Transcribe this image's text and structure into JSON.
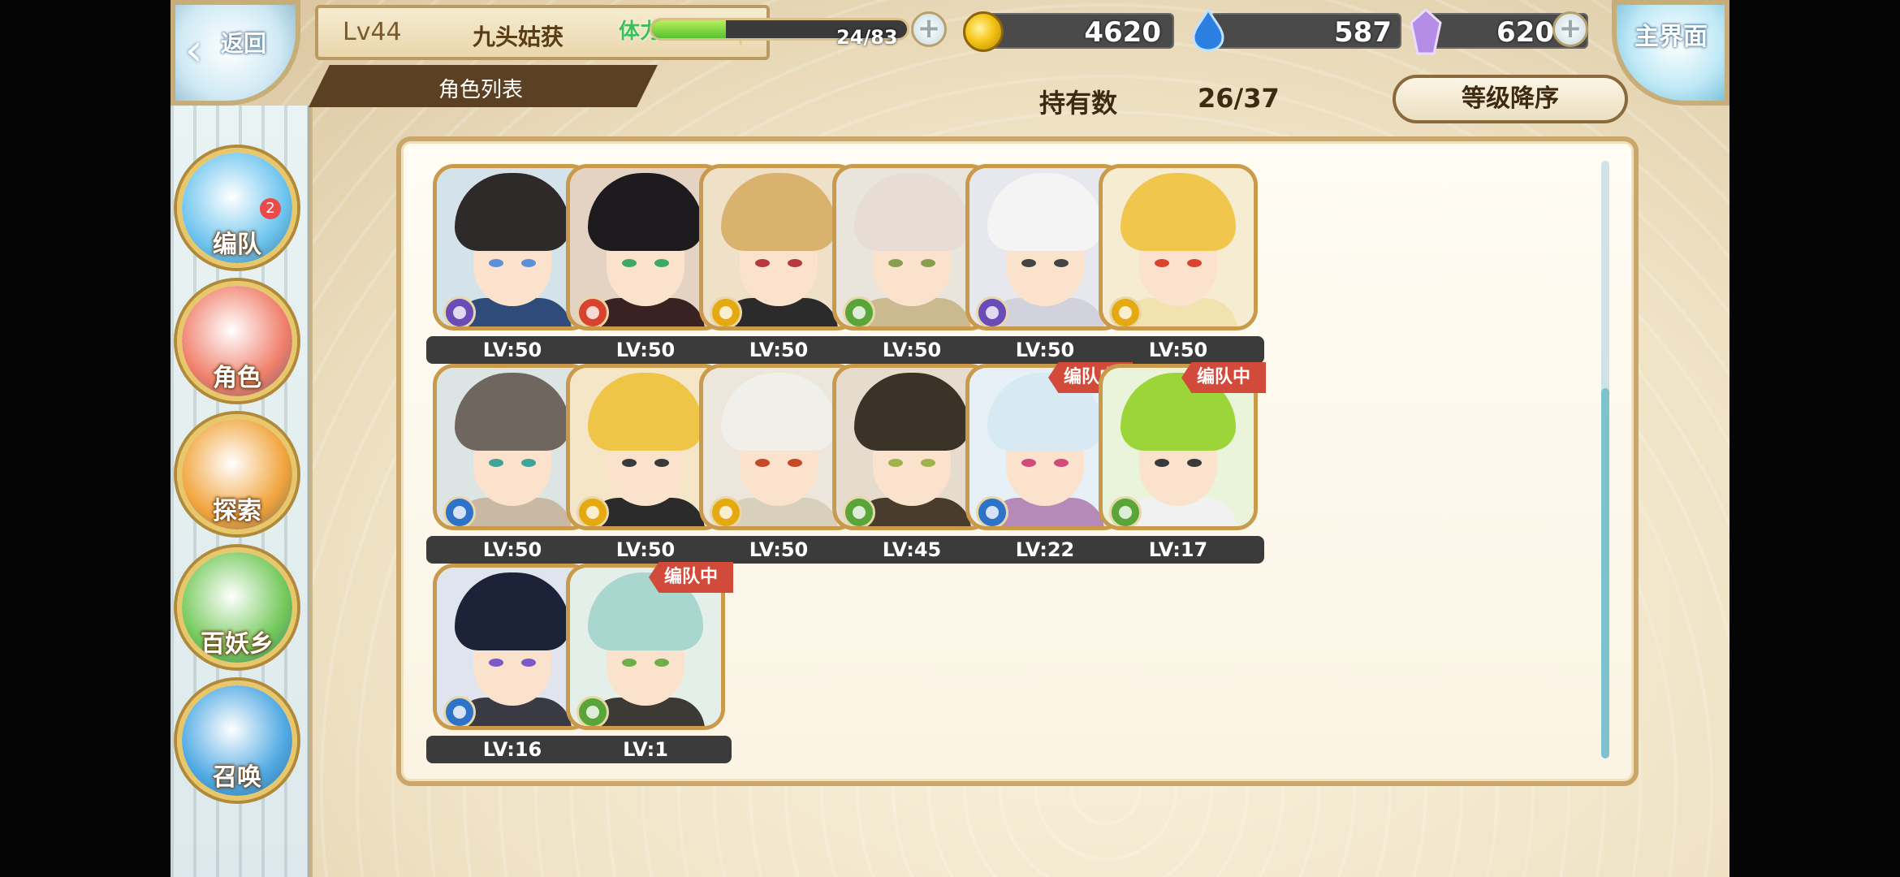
{
  "header": {
    "back_label": "返回",
    "player_level": "Lv44",
    "player_name": "九头姑获",
    "screen_title": "角色列表",
    "home_label": "主界面"
  },
  "resources": {
    "stamina_label": "体力",
    "stamina_current": 24,
    "stamina_max": 83,
    "stamina_text": "24/83",
    "gold": "4620",
    "spirit": "587",
    "crystal": "620",
    "colors": {
      "stamina": "#6fd43a",
      "gold": "#f5c518",
      "spirit": "#2a7fe0",
      "crystal": "#b58ce6"
    }
  },
  "sidebar": {
    "items": [
      {
        "label": "编队",
        "icon": "team-icon",
        "badge": "2",
        "color": "#6cc4ee"
      },
      {
        "label": "角色",
        "icon": "character-icon",
        "color": "#f07f6b"
      },
      {
        "label": "探索",
        "icon": "explore-icon",
        "color": "#f1a43c"
      },
      {
        "label": "百妖乡",
        "icon": "village-icon",
        "color": "#74c95b"
      },
      {
        "label": "召唤",
        "icon": "summon-icon",
        "color": "#4fa9e3"
      }
    ]
  },
  "roster": {
    "count_label": "持有数",
    "count_value": "26/37",
    "sort_label": "等级降序",
    "team_badge_text": "编队中",
    "scroll_position": 0.38,
    "characters": [
      {
        "level": "LV:50",
        "element": "purple",
        "hair": "#2f2a2a",
        "eye": "#5c8fd8",
        "bg": "#d4e3ea",
        "outfit": "#2e4b7a",
        "in_team": false
      },
      {
        "level": "LV:50",
        "element": "red",
        "hair": "#1e1b1f",
        "eye": "#3ea86b",
        "bg": "#e4d2c2",
        "outfit": "#3a2222",
        "in_team": false
      },
      {
        "level": "LV:50",
        "element": "yellow",
        "hair": "#d9b26e",
        "eye": "#b6393f",
        "bg": "#efe0c8",
        "outfit": "#2b2b2b",
        "in_team": false
      },
      {
        "level": "LV:50",
        "element": "green",
        "hair": "#e8ddd4",
        "eye": "#8a9e52",
        "bg": "#e9e4dc",
        "outfit": "#cbb98f",
        "in_team": false
      },
      {
        "level": "LV:50",
        "element": "purple",
        "hair": "#f4f4f4",
        "eye": "#444444",
        "bg": "#e7e7ee",
        "outfit": "#d2d2dc",
        "in_team": false
      },
      {
        "level": "LV:50",
        "element": "yellow",
        "hair": "#f0c64c",
        "eye": "#d9452e",
        "bg": "#f6ecd2",
        "outfit": "#f2e2b0",
        "in_team": false
      },
      {
        "level": "LV:50",
        "element": "blue",
        "hair": "#6f6660",
        "eye": "#3fa39a",
        "bg": "#dde4e4",
        "outfit": "#c9b8a4",
        "in_team": false
      },
      {
        "level": "LV:50",
        "element": "yellow",
        "hair": "#efc548",
        "eye": "#3a3a3a",
        "bg": "#f4e6c6",
        "outfit": "#2b2b2b",
        "in_team": false
      },
      {
        "level": "LV:50",
        "element": "yellow",
        "hair": "#f1efe9",
        "eye": "#c44a2a",
        "bg": "#ece6dc",
        "outfit": "#d9cfbd",
        "in_team": false
      },
      {
        "level": "LV:45",
        "element": "green",
        "hair": "#3b3228",
        "eye": "#9fb24b",
        "bg": "#e6dccd",
        "outfit": "#4a3c2c",
        "in_team": false
      },
      {
        "level": "LV:22",
        "element": "blue",
        "hair": "#d7e9f3",
        "eye": "#d04a7a",
        "bg": "#e6f0f6",
        "outfit": "#b58ab8",
        "in_team": true
      },
      {
        "level": "LV:17",
        "element": "green",
        "hair": "#9cd53a",
        "eye": "#3a3a3a",
        "bg": "#eaf4da",
        "outfit": "#f1f1f1",
        "in_team": true
      },
      {
        "level": "LV:16",
        "element": "blue",
        "hair": "#1c2338",
        "eye": "#7a5ac9",
        "bg": "#dfe4ee",
        "outfit": "#3a3a44",
        "in_team": false
      },
      {
        "level": "LV:1",
        "element": "green",
        "hair": "#a9d6cf",
        "eye": "#6fae4a",
        "bg": "#e5efe9",
        "outfit": "#3d3a36",
        "in_team": true
      }
    ]
  }
}
